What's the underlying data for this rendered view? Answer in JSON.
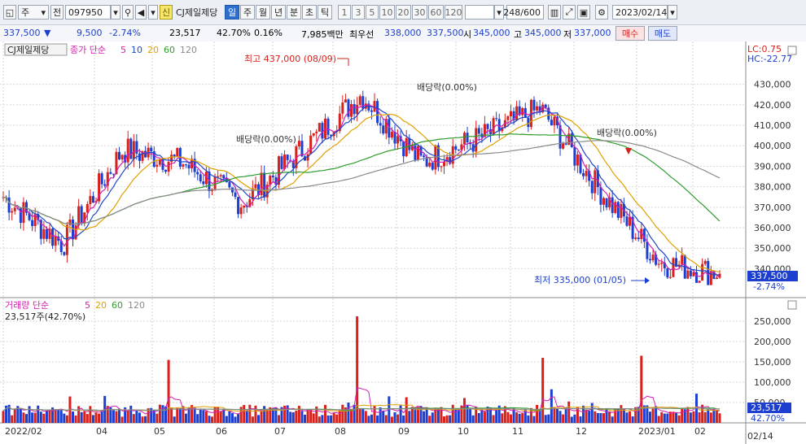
{
  "toolbar": {
    "market_type": "주",
    "category": "전",
    "stock_code": "097950",
    "new_badge": "신",
    "stock_name": "CJ제일제당",
    "periods": [
      "일",
      "주",
      "월",
      "년",
      "분",
      "초",
      "틱"
    ],
    "active_period": "일",
    "intervals": [
      "1",
      "3",
      "5",
      "10",
      "20",
      "30",
      "60",
      "120"
    ],
    "bar_count": "248/600",
    "date": "2023/02/14"
  },
  "quote": {
    "price": "337,500",
    "change_arrow": "▼",
    "change": "9,500",
    "change_pct": "-2.74%",
    "volume": "23,517",
    "volume_ratio": "42.70%",
    "turnover": "0.16%",
    "trade_value": "7,985백만",
    "best_ask_label": "최우선",
    "best_ask": "338,000",
    "best_bid": "337,500",
    "open_label": "시",
    "open": "345,000",
    "high_label": "고",
    "high": "345,000",
    "low_label": "저",
    "low": "337,000",
    "buy_label": "매수",
    "sell_label": "매도"
  },
  "price_panel": {
    "title": "CJ제일제당",
    "legend_label": "종가 단순",
    "ma_periods": [
      "5",
      "10",
      "20",
      "60",
      "120"
    ],
    "ma_colors": [
      "#d21fb0",
      "#1f47c9",
      "#e0a000",
      "#2e9c2e",
      "#8a8a8a"
    ],
    "lc_label": "LC:0.75",
    "hc_label": "HC:-22.77",
    "high_annotation": "최고 437,000 (08/09)",
    "low_annotation": "최저 335,000 (01/05)",
    "dividend_label": "배당락(0.00%)",
    "current_price_tag": "337,500",
    "current_pct_tag": "-2.74%",
    "y_ticks": [
      "430,000",
      "420,000",
      "410,000",
      "400,000",
      "390,000",
      "380,000",
      "370,000",
      "360,000",
      "350,000",
      "340,000"
    ]
  },
  "volume_panel": {
    "legend_label": "거래량 단순",
    "ma_periods": [
      "5",
      "20",
      "60",
      "120"
    ],
    "current_volume": "23,517주(42.70%)",
    "y_ticks": [
      "250,000",
      "200,000",
      "150,000",
      "100,000",
      "50,000"
    ],
    "current_tag": "23,517",
    "current_pct_tag": "42.70%"
  },
  "x_axis": {
    "labels": [
      "2022/02",
      "04",
      "05",
      "06",
      "07",
      "08",
      "09",
      "10",
      "11",
      "12",
      "2023/01",
      "02"
    ],
    "right_label": "02/14"
  },
  "colors": {
    "up": "#d9211c",
    "down": "#1d3fcf",
    "grid": "#c8c8c8"
  },
  "chart_data": {
    "type": "candlestick",
    "title": "CJ제일제당",
    "period": "daily",
    "x_range": [
      "2022/02",
      "2023/02/14"
    ],
    "price_ylim": [
      335000,
      437000
    ],
    "key_prices": {
      "high": {
        "value": 437000,
        "date": "08/09"
      },
      "low": {
        "value": 335000,
        "date": "01/05"
      },
      "last": {
        "value": 337500,
        "date": "02/14"
      }
    },
    "series": [
      {
        "name": "종가",
        "points": [
          {
            "month": "2022/02",
            "price": 375000
          },
          {
            "month": "03",
            "price": 352000
          },
          {
            "month": "04",
            "price": 398000
          },
          {
            "month": "05",
            "price": 392000
          },
          {
            "month": "06",
            "price": 372000
          },
          {
            "month": "07",
            "price": 398000
          },
          {
            "month": "08",
            "price": 425000
          },
          {
            "month": "09",
            "price": 392000
          },
          {
            "month": "10",
            "price": 404000
          },
          {
            "month": "11",
            "price": 418000
          },
          {
            "month": "12",
            "price": 378000
          },
          {
            "month": "2023/01",
            "price": 343000
          },
          {
            "month": "02",
            "price": 337500
          }
        ]
      }
    ],
    "volume_ylim": [
      0,
      250000
    ],
    "volume_spikes": [
      {
        "month": "08",
        "value": 262000
      },
      {
        "month": "2023/01",
        "value": 165000
      },
      {
        "month": "11",
        "value": 160000
      },
      {
        "month": "05",
        "value": 155000
      }
    ],
    "volume_last": 23517
  }
}
